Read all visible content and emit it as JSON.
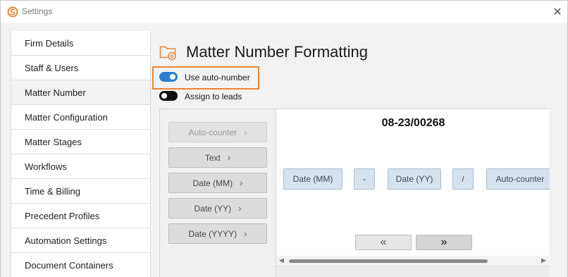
{
  "window": {
    "title": "Settings",
    "close_icon": "close-icon",
    "logo_icon": "app-logo-icon",
    "accent_color": "#e8873a"
  },
  "sidebar": {
    "items": [
      {
        "label": "Firm Details"
      },
      {
        "label": "Staff & Users"
      },
      {
        "label": "Matter Number",
        "selected": true
      },
      {
        "label": "Matter Configuration"
      },
      {
        "label": "Matter Stages"
      },
      {
        "label": "Workflows"
      },
      {
        "label": "Time & Billing"
      },
      {
        "label": "Precedent Profiles"
      },
      {
        "label": "Automation Settings"
      },
      {
        "label": "Document Containers"
      }
    ]
  },
  "page": {
    "title": "Matter Number Formatting",
    "icon": "folder-gear-icon"
  },
  "toggles": {
    "auto_number": {
      "label": "Use auto-number",
      "on": true
    },
    "assign_leads": {
      "label": "Assign to leads",
      "on": false
    }
  },
  "token_buttons": [
    {
      "label": "Auto-counter",
      "disabled": true
    },
    {
      "label": "Text",
      "disabled": false
    },
    {
      "label": "Date (MM)",
      "disabled": false
    },
    {
      "label": "Date (YY)",
      "disabled": false
    },
    {
      "label": "Date (YYYY)",
      "disabled": false
    }
  ],
  "preview": {
    "value": "08-23/00268",
    "chips": [
      "Date (MM)",
      "-",
      "Date (YY)",
      "/",
      "Auto-counter"
    ],
    "nav_left": "«",
    "nav_right": "»"
  }
}
